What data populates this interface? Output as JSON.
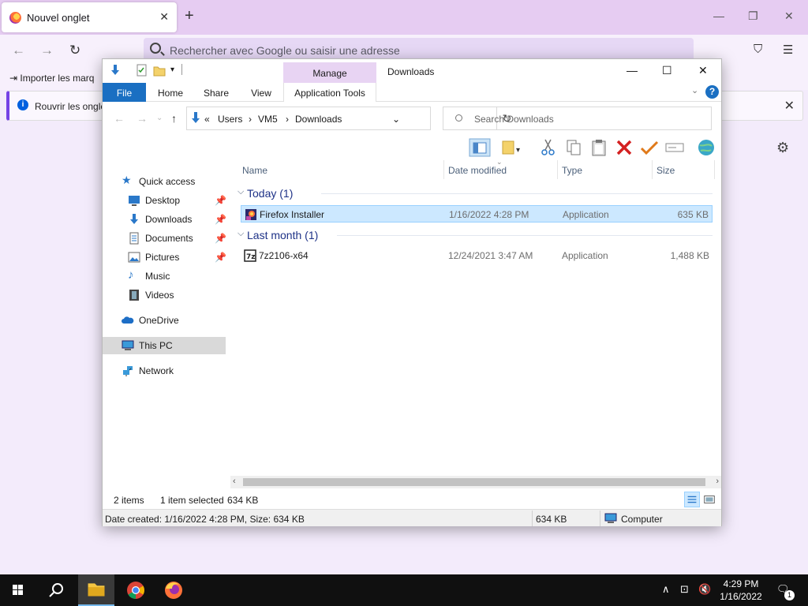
{
  "firefox": {
    "tab_title": "Nouvel onglet",
    "url_placeholder": "Rechercher avec Google ou saisir une adresse",
    "bookmark_import": "Importer les marq",
    "info_bar_text": "Rouvrir les onglet"
  },
  "explorer": {
    "title": "Downloads",
    "context_tab": "Manage",
    "ribbon_tabs": [
      "File",
      "Home",
      "Share",
      "View",
      "Application Tools"
    ],
    "breadcrumb": [
      "Users",
      "VM5",
      "Downloads"
    ],
    "breadcrumb_overflow": "«",
    "search_placeholder": "Search Downloads",
    "nav": {
      "quick_access": "Quick access",
      "pinned": [
        "Desktop",
        "Downloads",
        "Documents",
        "Pictures"
      ],
      "unpinned": [
        "Music",
        "Videos"
      ],
      "onedrive": "OneDrive",
      "this_pc": "This PC",
      "network": "Network"
    },
    "columns": [
      "Name",
      "Date modified",
      "Type",
      "Size"
    ],
    "groups": [
      {
        "label": "Today (1)",
        "files": [
          {
            "name": "Firefox Installer",
            "date": "1/16/2022 4:28 PM",
            "type": "Application",
            "size": "635 KB",
            "selected": true
          }
        ]
      },
      {
        "label": "Last month (1)",
        "files": [
          {
            "name": "7z2106-x64",
            "date": "12/24/2021 3:47 AM",
            "type": "Application",
            "size": "1,488 KB",
            "selected": false
          }
        ]
      }
    ],
    "status": {
      "items": "2 items",
      "selected": "1 item selected",
      "selected_size": "634 KB"
    },
    "details": {
      "info": "Date created: 1/16/2022 4:28 PM, Size: 634 KB",
      "size": "634 KB",
      "location": "Computer"
    }
  },
  "taskbar": {
    "time": "4:29 PM",
    "date": "1/16/2022",
    "notification_count": "1"
  }
}
